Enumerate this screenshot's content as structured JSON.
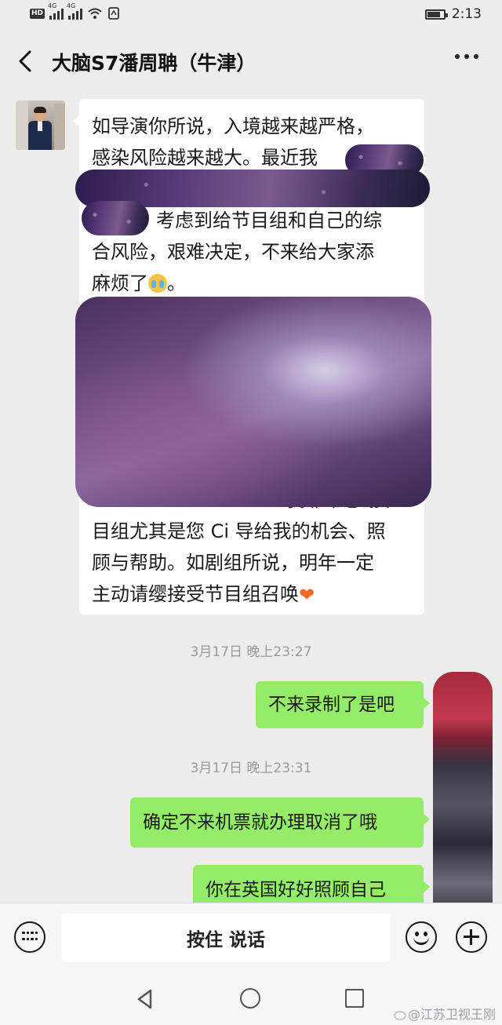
{
  "status_bar": {
    "hd_badge": "HD",
    "network_label_1": "4G",
    "network_label_2": "4G",
    "time": "2:13",
    "battery_level": 0.8
  },
  "header": {
    "title": "大脑S7潘周聃（牛津）",
    "back_icon": "chevron-left-icon",
    "more_icon": "more-dots-icon"
  },
  "messages": {
    "incoming": {
      "line1": "如导演你所说，入境越来越严格，",
      "line2": "感染风险越来越大。最近我",
      "line3": "考虑到给节目组和自己的综",
      "line4": "合风险，艰难决定，不来给大家添",
      "line5": "麻烦了",
      "line5_end": "。",
      "line6": "我非常感谢节",
      "line7": "目组尤其是您 Ci 导给我的机会、照",
      "line8": "顾与帮助。如剧组所说，明年一定",
      "line9": "主动请缨接受节目组召唤",
      "heart": "❤"
    },
    "time1": "3月17日 晚上23:27",
    "out1": "不来录制了是吧",
    "time2": "3月17日 晚上23:31",
    "out2": "确定不来机票就办理取消了哦",
    "out3": "你在英国好好照顾自己"
  },
  "input_bar": {
    "voice_label": "按住 说话",
    "keyboard_icon": "keyboard-icon",
    "emoji_icon": "emoji-icon",
    "plus_icon": "plus-icon"
  },
  "watermark": "@江苏卫视王刚",
  "colors": {
    "background": "#ededed",
    "outgoing_bubble": "#95ec69",
    "incoming_bubble": "#ffffff"
  }
}
